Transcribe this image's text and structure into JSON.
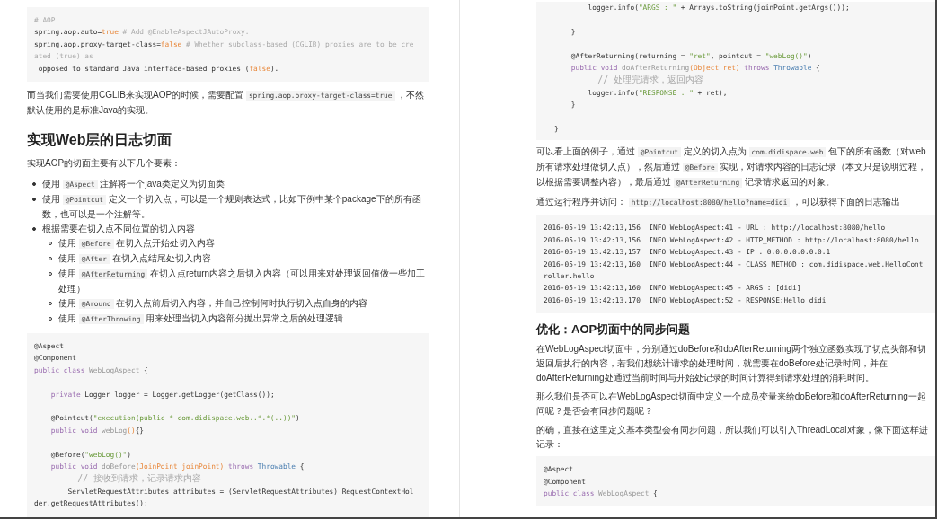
{
  "pages": [
    {
      "blocks": [
        {
          "kind": "code",
          "lines": [
            {
              "kind": "code",
              "tokens": [
                {
                  "text": "# AOP",
                  "kind": "comment"
                }
              ]
            },
            {
              "kind": "code",
              "tokens": [
                {
                  "text": "spring.aop.auto=",
                  "kind": "plain"
                },
                {
                  "text": "true",
                  "kind": "literal"
                },
                {
                  "text": " # Add @EnableAspectJAutoProxy.",
                  "kind": "comment"
                }
              ]
            },
            {
              "kind": "code",
              "tokens": [
                {
                  "text": "spring.aop.proxy-target-class=",
                  "kind": "plain"
                },
                {
                  "text": "false",
                  "kind": "literal"
                },
                {
                  "text": " # Whether subclass-based (CGLIB) proxies are to be cre",
                  "kind": "comment"
                }
              ]
            },
            {
              "kind": "code",
              "tokens": [
                {
                  "text": "ated (true) as",
                  "kind": "comment"
                }
              ]
            },
            {
              "kind": "code",
              "tokens": [
                {
                  "text": " opposed to standard Java interface-based proxies (",
                  "kind": "plain"
                },
                {
                  "text": "false",
                  "kind": "literal"
                },
                {
                  "text": ").",
                  "kind": "plain"
                }
              ]
            }
          ]
        },
        {
          "kind": "paragraph",
          "lines": [
            [
              {
                "text": "而当我们需要使用CGLIB来实现AOP的时候，需要配置 ",
                "kind": "text"
              },
              {
                "text": "spring.aop.proxy-target-class=true",
                "kind": "code"
              },
              {
                "text": " ，不然",
                "kind": "text"
              }
            ],
            [
              {
                "text": "默认使用的是标准Java的实现。",
                "kind": "text"
              }
            ]
          ]
        },
        {
          "kind": "heading",
          "text": "实现Web层的日志切面"
        },
        {
          "kind": "paragraph",
          "lines": [
            [
              {
                "text": "实现AOP的切面主要有以下几个要素：",
                "kind": "text"
              }
            ]
          ]
        },
        {
          "kind": "list",
          "items": [
            {
              "lines": [
                [
                  {
                    "text": "使用 ",
                    "kind": "text"
                  },
                  {
                    "text": "@Aspect",
                    "kind": "code"
                  },
                  {
                    "text": " 注解将一个java类定义为切面类",
                    "kind": "text"
                  }
                ]
              ]
            },
            {
              "lines": [
                [
                  {
                    "text": "使用 ",
                    "kind": "text"
                  },
                  {
                    "text": "@Pointcut",
                    "kind": "code"
                  },
                  {
                    "text": " 定义一个切入点，可以是一个规则表达式，比如下例中某个package下的所有函",
                    "kind": "text"
                  }
                ],
                [
                  {
                    "text": "数，也可以是一个注解等。",
                    "kind": "text"
                  }
                ]
              ]
            },
            {
              "lines": [
                [
                  {
                    "text": "根据需要在切入点不同位置的切入内容",
                    "kind": "text"
                  }
                ]
              ],
              "children": [
                {
                  "lines": [
                    [
                      {
                        "text": "使用 ",
                        "kind": "text"
                      },
                      {
                        "text": "@Before",
                        "kind": "code"
                      },
                      {
                        "text": " 在切入点开始处切入内容",
                        "kind": "text"
                      }
                    ]
                  ]
                },
                {
                  "lines": [
                    [
                      {
                        "text": "使用 ",
                        "kind": "text"
                      },
                      {
                        "text": "@After",
                        "kind": "code"
                      },
                      {
                        "text": " 在切入点结尾处切入内容",
                        "kind": "text"
                      }
                    ]
                  ]
                },
                {
                  "lines": [
                    [
                      {
                        "text": "使用 ",
                        "kind": "text"
                      },
                      {
                        "text": "@AfterReturning",
                        "kind": "code"
                      },
                      {
                        "text": " 在切入点return内容之后切入内容（可以用来对处理返回值做一些加工",
                        "kind": "text"
                      }
                    ],
                    [
                      {
                        "text": "处理）",
                        "kind": "text"
                      }
                    ]
                  ]
                },
                {
                  "lines": [
                    [
                      {
                        "text": "使用 ",
                        "kind": "text"
                      },
                      {
                        "text": "@Around",
                        "kind": "code"
                      },
                      {
                        "text": " 在切入点前后切入内容，并自己控制何时执行切入点自身的内容",
                        "kind": "text"
                      }
                    ]
                  ]
                },
                {
                  "lines": [
                    [
                      {
                        "text": "使用 ",
                        "kind": "text"
                      },
                      {
                        "text": "@AfterThrowing",
                        "kind": "code"
                      },
                      {
                        "text": " 用来处理当切入内容部分抛出异常之后的处理逻辑",
                        "kind": "text"
                      }
                    ]
                  ]
                }
              ]
            }
          ]
        },
        {
          "kind": "code",
          "lines": [
            {
              "kind": "code",
              "tokens": [
                {
                  "text": "@Aspect",
                  "kind": "plain"
                }
              ]
            },
            {
              "kind": "code",
              "tokens": [
                {
                  "text": "@Component",
                  "kind": "plain"
                }
              ]
            },
            {
              "kind": "code",
              "tokens": [
                {
                  "text": "public class",
                  "kind": "keyword"
                },
                {
                  "text": " WebLogAspect",
                  "kind": "name"
                },
                {
                  "text": " {",
                  "kind": "plain"
                }
              ]
            },
            {
              "kind": "blank"
            },
            {
              "kind": "code",
              "tokens": [
                {
                  "text": "    private",
                  "kind": "keyword"
                },
                {
                  "text": " Logger logger = Logger.getLogger(getClass());",
                  "kind": "plain"
                }
              ]
            },
            {
              "kind": "blank"
            },
            {
              "kind": "code",
              "tokens": [
                {
                  "text": "    @Pointcut(",
                  "kind": "plain"
                },
                {
                  "text": "\"execution(public * com.didispace.web..*.*(..))\"",
                  "kind": "string"
                },
                {
                  "text": ")",
                  "kind": "plain"
                }
              ]
            },
            {
              "kind": "code",
              "tokens": [
                {
                  "text": "    public void",
                  "kind": "keyword"
                },
                {
                  "text": " webLog",
                  "kind": "name"
                },
                {
                  "text": "()",
                  "kind": "literal"
                },
                {
                  "text": "{}",
                  "kind": "plain"
                }
              ]
            },
            {
              "kind": "blank"
            },
            {
              "kind": "code",
              "tokens": [
                {
                  "text": "    @Before(",
                  "kind": "plain"
                },
                {
                  "text": "\"webLog()\"",
                  "kind": "string"
                },
                {
                  "text": ")",
                  "kind": "plain"
                }
              ]
            },
            {
              "kind": "code",
              "tokens": [
                {
                  "text": "    public void",
                  "kind": "keyword"
                },
                {
                  "text": " doBefore",
                  "kind": "name"
                },
                {
                  "text": "(JoinPoint joinPoint)",
                  "kind": "literal"
                },
                {
                  "text": " throws",
                  "kind": "keyword"
                },
                {
                  "text": " Throwable",
                  "kind": "type"
                },
                {
                  "text": " {",
                  "kind": "plain"
                }
              ]
            },
            {
              "kind": "code",
              "tokens": [
                {
                  "text": "        // 接收到请求，记录请求内容",
                  "kind": "comment"
                }
              ]
            },
            {
              "kind": "code",
              "tokens": [
                {
                  "text": "        ServletRequestAttributes attributes = (ServletRequestAttributes) RequestContextHol",
                  "kind": "plain"
                }
              ]
            },
            {
              "kind": "code",
              "tokens": [
                {
                  "text": "der.getRequestAttributes();",
                  "kind": "plain"
                }
              ]
            }
          ]
        }
      ]
    },
    {
      "blocks": [
        {
          "kind": "code",
          "lines": [
            {
              "kind": "code",
              "tokens": [
                {
                  "text": "        logger.info(",
                  "kind": "plain"
                },
                {
                  "text": "\"ARGS : \"",
                  "kind": "string"
                },
                {
                  "text": " + Arrays.toString(joinPoint.getArgs()));",
                  "kind": "plain"
                }
              ]
            },
            {
              "kind": "blank"
            },
            {
              "kind": "code",
              "tokens": [
                {
                  "text": "    }",
                  "kind": "plain"
                }
              ]
            },
            {
              "kind": "blank"
            },
            {
              "kind": "code",
              "tokens": [
                {
                  "text": "    @AfterReturning(returning = ",
                  "kind": "plain"
                },
                {
                  "text": "\"ret\"",
                  "kind": "string"
                },
                {
                  "text": ", pointcut = ",
                  "kind": "plain"
                },
                {
                  "text": "\"webLog()\"",
                  "kind": "string"
                },
                {
                  "text": ")",
                  "kind": "plain"
                }
              ]
            },
            {
              "kind": "code",
              "tokens": [
                {
                  "text": "    public void",
                  "kind": "keyword"
                },
                {
                  "text": " doAfterReturning",
                  "kind": "name"
                },
                {
                  "text": "(Object ret)",
                  "kind": "literal"
                },
                {
                  "text": " throws",
                  "kind": "keyword"
                },
                {
                  "text": " Throwable",
                  "kind": "type"
                },
                {
                  "text": " {",
                  "kind": "plain"
                }
              ]
            },
            {
              "kind": "code",
              "tokens": [
                {
                  "text": "        // 处理完请求，返回内容",
                  "kind": "comment"
                }
              ]
            },
            {
              "kind": "code",
              "tokens": [
                {
                  "text": "        logger.info(",
                  "kind": "plain"
                },
                {
                  "text": "\"RESPONSE : \"",
                  "kind": "string"
                },
                {
                  "text": " + ret);",
                  "kind": "plain"
                }
              ]
            },
            {
              "kind": "code",
              "tokens": [
                {
                  "text": "    }",
                  "kind": "plain"
                }
              ]
            },
            {
              "kind": "blank"
            },
            {
              "kind": "code",
              "tokens": [
                {
                  "text": "}",
                  "kind": "plain"
                }
              ]
            }
          ]
        },
        {
          "kind": "paragraph",
          "lines": [
            [
              {
                "text": "可以看上面的例子，通过 ",
                "kind": "text"
              },
              {
                "text": "@Pointcut",
                "kind": "code"
              },
              {
                "text": " 定义的切入点为 ",
                "kind": "text"
              },
              {
                "text": "com.didispace.web",
                "kind": "code"
              },
              {
                "text": " 包下的所有函数（对web",
                "kind": "text"
              }
            ],
            [
              {
                "text": "所有请求处理做切入点），然后通过 ",
                "kind": "text"
              },
              {
                "text": "@Before",
                "kind": "code"
              },
              {
                "text": " 实现，对请求内容的日志记录（本文只是说明过程，",
                "kind": "text"
              }
            ],
            [
              {
                "text": "以根据需要调整内容），最后通过 ",
                "kind": "text"
              },
              {
                "text": "@AfterReturning",
                "kind": "code"
              },
              {
                "text": " 记录请求返回的对象。",
                "kind": "text"
              }
            ]
          ]
        },
        {
          "kind": "paragraph",
          "lines": [
            [
              {
                "text": "通过运行程序并访问： ",
                "kind": "text"
              },
              {
                "text": "http://localhost:8080/hello?name=didi",
                "kind": "code"
              },
              {
                "text": " ，可以获得下面的日志输出",
                "kind": "text"
              }
            ]
          ]
        },
        {
          "kind": "code",
          "lines": [
            {
              "kind": "code",
              "tokens": [
                {
                  "text": "2016-05-19 13:42:13,156  INFO WebLogAspect:41 - URL : http://localhost:8080/hello",
                  "kind": "plain"
                }
              ]
            },
            {
              "kind": "code",
              "tokens": [
                {
                  "text": "2016-05-19 13:42:13,156  INFO WebLogAspect:42 - HTTP_METHOD : http://localhost:8080/hello",
                  "kind": "plain"
                }
              ]
            },
            {
              "kind": "code",
              "tokens": [
                {
                  "text": "2016-05-19 13:42:13,157  INFO WebLogAspect:43 - IP : 0:0:0:0:0:0:0:1",
                  "kind": "plain"
                }
              ]
            },
            {
              "kind": "code",
              "tokens": [
                {
                  "text": "2016-05-19 13:42:13,160  INFO WebLogAspect:44 - CLASS_METHOD : com.didispace.web.HelloCont",
                  "kind": "plain"
                }
              ]
            },
            {
              "kind": "code",
              "tokens": [
                {
                  "text": "roller.hello",
                  "kind": "plain"
                }
              ]
            },
            {
              "kind": "code",
              "tokens": [
                {
                  "text": "2016-05-19 13:42:13,160  INFO WebLogAspect:45 - ARGS : [didi]",
                  "kind": "plain"
                }
              ]
            },
            {
              "kind": "code",
              "tokens": [
                {
                  "text": "2016-05-19 13:42:13,170  INFO WebLogAspect:52 - RESPONSE:Hello didi",
                  "kind": "plain"
                }
              ]
            }
          ]
        },
        {
          "kind": "heading",
          "text": "优化：AOP切面中的同步问题"
        },
        {
          "kind": "paragraph",
          "lines": [
            [
              {
                "text": "在WebLogAspect切面中，分别通过doBefore和doAfterReturning两个独立函数实现了切点头部和切",
                "kind": "text"
              }
            ],
            [
              {
                "text": "返回后执行的内容，若我们想统计请求的处理时间，就需要在doBefore处记录时间，并在",
                "kind": "text"
              }
            ],
            [
              {
                "text": "doAfterReturning处通过当前时间与开始处记录的时间计算得到请求处理的消耗时间。",
                "kind": "text"
              }
            ]
          ]
        },
        {
          "kind": "paragraph",
          "lines": [
            [
              {
                "text": "那么我们是否可以在WebLogAspect切面中定义一个成员变量来给doBefore和doAfterReturning一起",
                "kind": "text"
              }
            ],
            [
              {
                "text": "问呢？是否会有同步问题呢？",
                "kind": "text"
              }
            ]
          ]
        },
        {
          "kind": "paragraph",
          "lines": [
            [
              {
                "text": "的确，直接在这里定义基本类型会有同步问题，所以我们可以引入ThreadLocal对象，像下面这样进",
                "kind": "text"
              }
            ],
            [
              {
                "text": "记录：",
                "kind": "text"
              }
            ]
          ]
        },
        {
          "kind": "code",
          "lines": [
            {
              "kind": "code",
              "tokens": [
                {
                  "text": "@Aspect",
                  "kind": "plain"
                }
              ]
            },
            {
              "kind": "code",
              "tokens": [
                {
                  "text": "@Component",
                  "kind": "plain"
                }
              ]
            },
            {
              "kind": "code",
              "tokens": [
                {
                  "text": "public class",
                  "kind": "keyword"
                },
                {
                  "text": " WebLogAspect",
                  "kind": "name"
                },
                {
                  "text": " {",
                  "kind": "plain"
                }
              ]
            }
          ]
        }
      ]
    }
  ]
}
